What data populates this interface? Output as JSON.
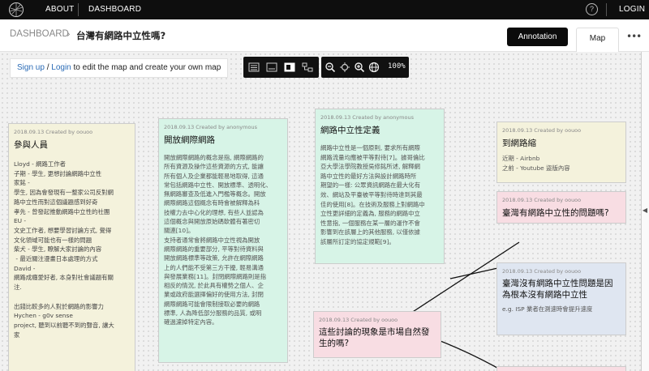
{
  "nav": {
    "about": "ABOUT",
    "dashboard": "DASHBOARD",
    "help": "?",
    "login": "LOGIN"
  },
  "header": {
    "crumb": "DASHBOARD",
    "crumb_sep": "›",
    "title": "台灣有網路中立性嗎?",
    "annotation_button": "Annotation",
    "map_tab": "Map",
    "more": "•••"
  },
  "signup": {
    "signup_link": "Sign up",
    "slash": " / ",
    "login_link": "Login",
    "rest": " to edit the map and create your own map"
  },
  "toolbar": {
    "zoom": "100%",
    "icons": [
      "list-icon",
      "card-icon",
      "document-icon",
      "tree-icon",
      "zoom-out-icon",
      "locate-icon",
      "zoom-in-icon",
      "globe-icon"
    ]
  },
  "cards": [
    {
      "meta": "2018.09.13 Created by oouoo",
      "title": "參與人員",
      "body": "Lloyd - 網路工作者\n子期 - 學生, 更想討論網路中立性\n家銘 -\n學生, 因為會發現有一整家公司反對網\n路中立性而對這個議題感到好奇\n孝先 - 曾發起推動網路中立性的社團\nEU -\n文史工作者, 想要學習討論方式, 覺得\n文化領域可能也有一樣的問題\n柴犬 - 學生, 瞭解大家討論的內容\n - 最近關注漫畫日本處理的方式\nDavid -\n網路成癮愛好者, 本身對社會議題有關\n注.\n\n出錢比較多的人對於網路的影響力\nHychen - g0v sense\nproject, 聽到以前聽不到的聲音, 讓大\n家"
    },
    {
      "meta": "2018.09.13 Created by anonymous",
      "title": "開放網際網路",
      "body": "開放網際網路的概念是指, 網際網路的\n所有資源及操作這些資源的方式, 能讓\n所有個人及企業都能輕易地取得, 這通\n常包括網路中立性、開放標準、透明化、\n無網路審查及低進入門檻等概念。開放\n網際網路這個概念有時會被解釋為科\n技權力去中心化的理想, 有些人並認為\n這個概念與開放原始碼軟體有著密切\n關連[10]。\n支持者通常會將網路中立性視為開放\n網際網路的重要部分, 平等對待資料與\n開放網路標準等政策, 允許在網際網路\n上的人們能不受第三方干擾, 輕易溝通\n與發展業務[11]。封閉網際網路則是指\n相反的情況, 於此具有權勢之個人、企\n業或政府能選擇偏好的使用方法, 封閉\n網際網路可能會限制接取必要的網路\n標準, 人為降低部分服務的品質, 或明\n確過濾掉特定內容。"
    },
    {
      "meta": "2018.09.13 Created by anonymous",
      "title": "網路中立性定義",
      "body": "網路中立性是一個原則, 要求所有網際\n網路流量均應被平等對待[7]。據哥倫比\n亞大學法學院教授吳修銘所述, 解釋網\n路中立性的最好方法與設計網路時所\n期望的一樣: 公眾資訊網路在最大化有\n效、網站及平臺被平等對待時達到其最\n佳的使用[8]。在技術及服務上對網路中\n立性更詳細的定義為, 服務的網路中立\n性意指, 一個服務在某一層的運作不會\n影響到在該層上的其他服務, 以僅依據\n該層所訂定的協定規範[9]。"
    },
    {
      "meta": "2018.09.13 Created by oouoo",
      "title": "到網路縮",
      "body": "近期 - Airbnb\n之前 - Youtube 盜版內容"
    },
    {
      "meta": "2018.09.13 Created by oouoo",
      "title": "臺灣有網路中立性的問題嗎?",
      "body": ""
    },
    {
      "meta": "2018.09.13 Created by oouoo",
      "title": "臺灣沒有網路中立性問題是因\n為根本沒有網路中立性",
      "body": "e.g. ISP 業者在測速時會提升速度"
    },
    {
      "meta": "2018.09.13 Created by oouoo",
      "title": "這些討論的現象是市場自然發\n生的嗎?",
      "body": ""
    }
  ],
  "colors": {
    "yellow": "#f4f2dc",
    "green": "#d7f4e7",
    "pink": "#f8dde3",
    "blue": "#dfe6f1",
    "link": "#2a6bb6"
  }
}
